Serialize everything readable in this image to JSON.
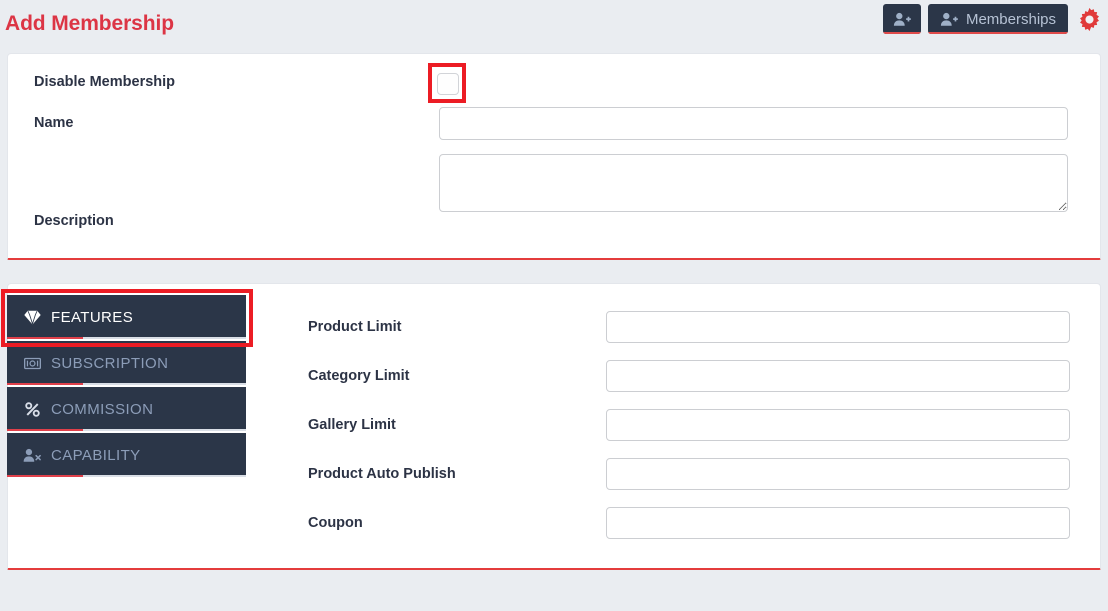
{
  "page": {
    "title": "Add Membership",
    "background_color": "#eaedf1",
    "accent_color": "#dc3545",
    "dark_color": "#2b3648"
  },
  "topbar": {
    "add_membership_button": {
      "icon": "user-plus-icon",
      "label": ""
    },
    "memberships_button": {
      "icon": "user-plus-icon",
      "label": "Memberships"
    },
    "settings_button": {
      "icon": "gear-icon",
      "color": "#e03a3a"
    }
  },
  "top_form": {
    "fields": [
      {
        "label": "Disable Membership",
        "type": "checkbox",
        "checked": false,
        "value": ""
      },
      {
        "label": "Name",
        "type": "text",
        "value": "",
        "placeholder": ""
      },
      {
        "label": "Description",
        "type": "textarea",
        "value": "",
        "placeholder": ""
      }
    ]
  },
  "tabs": [
    {
      "label": "FEATURES",
      "icon": "gem-icon",
      "active": true
    },
    {
      "label": "SUBSCRIPTION",
      "icon": "money-bill-icon",
      "active": false
    },
    {
      "label": "COMMISSION",
      "icon": "percent-icon",
      "active": false
    },
    {
      "label": "CAPABILITY",
      "icon": "user-times-icon",
      "active": false
    }
  ],
  "features_panel": {
    "fields": [
      {
        "label": "Product Limit",
        "value": "",
        "placeholder": ""
      },
      {
        "label": "Category Limit",
        "value": "",
        "placeholder": ""
      },
      {
        "label": "Gallery Limit",
        "value": "",
        "placeholder": ""
      },
      {
        "label": "Product Auto Publish",
        "value": "",
        "placeholder": ""
      },
      {
        "label": "Coupon",
        "value": "",
        "placeholder": ""
      }
    ]
  },
  "annotations": [
    {
      "name": "disable-membership-checkbox-highlight",
      "color": "#ec1c24"
    },
    {
      "name": "features-tab-highlight",
      "color": "#ec1c24"
    }
  ]
}
